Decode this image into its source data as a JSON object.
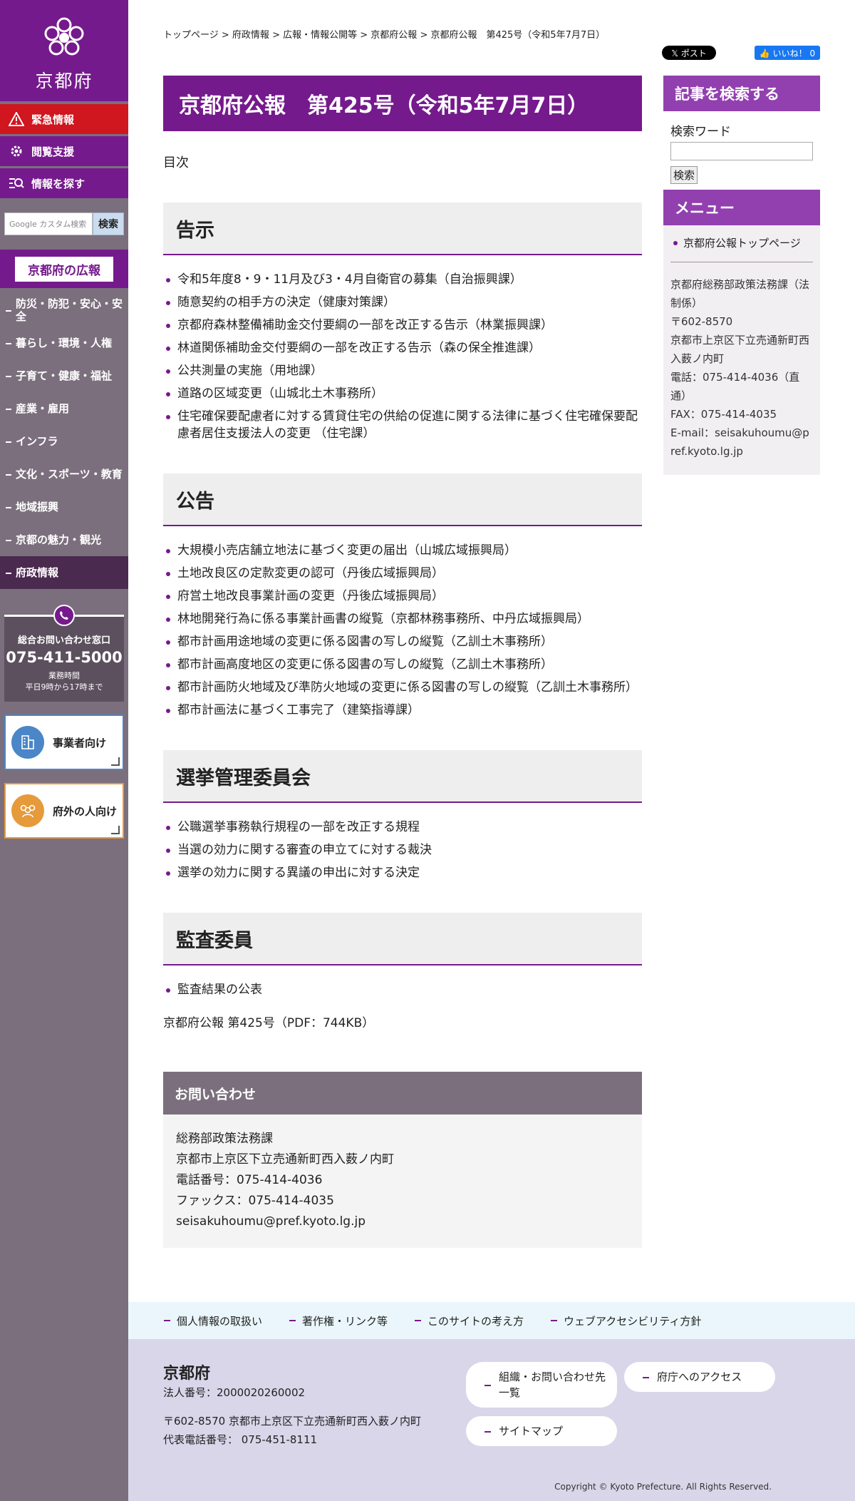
{
  "sidebar": {
    "logo_text": "京都府",
    "buttons": [
      {
        "label": "緊急情報"
      },
      {
        "label": "閲覧支援"
      },
      {
        "label": "情報を探す"
      }
    ],
    "search_placeholder": "Google カスタム検索",
    "search_button": "検索",
    "koho_label": "京都府の広報",
    "nav": [
      {
        "label": "防災・防犯・安心・安全",
        "active": false
      },
      {
        "label": "暮らし・環境・人権",
        "active": false
      },
      {
        "label": "子育て・健康・福祉",
        "active": false
      },
      {
        "label": "産業・雇用",
        "active": false
      },
      {
        "label": "インフラ",
        "active": false
      },
      {
        "label": "文化・スポーツ・教育",
        "active": false
      },
      {
        "label": "地域振興",
        "active": false
      },
      {
        "label": "京都の魅力・観光",
        "active": false
      },
      {
        "label": "府政情報",
        "active": true
      }
    ],
    "contact": {
      "title": "総合お問い合わせ窓口",
      "phone": "075-411-5000",
      "hours_label": "業務時間",
      "hours": "平日9時から17時まで"
    },
    "cards": [
      {
        "label": "事業者向け",
        "color": "#4a86c8"
      },
      {
        "label": "府外の人向け",
        "color": "#e69a3a"
      }
    ]
  },
  "breadcrumb": {
    "items": [
      "トップページ",
      "府政情報",
      "広報・情報公開等",
      "京都府公報"
    ],
    "separator": " > ",
    "current": "京都府公報　第425号（令和5年7月7日）"
  },
  "social": {
    "tweet": "𝕏 ポスト",
    "like": "👍 いいね！ 0"
  },
  "main": {
    "title": "京都府公報　第425号（令和5年7月7日）",
    "toc": "目次",
    "sections": [
      {
        "heading": "告示",
        "items": [
          "令和5年度8・9・11月及び3・4月自衛官の募集（自治振興課）",
          "随意契約の相手方の決定（健康対策課）",
          "京都府森林整備補助金交付要綱の一部を改正する告示（林業振興課）",
          "林道関係補助金交付要綱の一部を改正する告示（森の保全推進課）",
          "公共測量の実施（用地課）",
          "道路の区域変更（山城北土木事務所）",
          "住宅確保要配慮者に対する賃貸住宅の供給の促進に関する法律に基づく住宅確保要配慮者居住支援法人の変更 （住宅課）"
        ]
      },
      {
        "heading": "公告",
        "items": [
          "大規模小売店舗立地法に基づく変更の届出（山城広域振興局）",
          "土地改良区の定款変更の認可（丹後広域振興局）",
          "府営土地改良事業計画の変更（丹後広域振興局）",
          "林地開発行為に係る事業計画書の縦覧（京都林務事務所、中丹広域振興局）",
          "都市計画用途地域の変更に係る図書の写しの縦覧（乙訓土木事務所）",
          "都市計画高度地区の変更に係る図書の写しの縦覧（乙訓土木事務所）",
          "都市計画防火地域及び準防火地域の変更に係る図書の写しの縦覧（乙訓土木事務所）",
          "都市計画法に基づく工事完了（建築指導課）"
        ]
      },
      {
        "heading": "選挙管理委員会",
        "items": [
          "公職選挙事務執行規程の一部を改正する規程",
          "当選の効力に関する審査の申立てに対する裁決",
          "選挙の効力に関する異議の申出に対する決定"
        ]
      },
      {
        "heading": "監査委員",
        "items": [
          "監査結果の公表"
        ]
      }
    ],
    "pdf_link": "京都府公報 第425号（PDF：744KB）",
    "inquiry": {
      "heading": "お問い合わせ",
      "dept": "総務部政策法務課",
      "address": "京都市上京区下立売通新町西入薮ノ内町",
      "phone": "電話番号：075-414-4036",
      "fax": "ファックス：075-414-4035",
      "email": "seisakuhoumu@pref.kyoto.lg.jp"
    }
  },
  "right": {
    "search_heading": "記事を検索する",
    "search_label": "検索ワード",
    "search_button": "検索",
    "menu_heading": "メニュー",
    "menu_link": "京都府公報トップページ",
    "address_lines": [
      "京都府総務部政策法務課（法制係）",
      "〒602-8570",
      "京都市上京区下立売通新町西入薮ノ内町",
      "電話：075-414-4036（直通）",
      "FAX：075-414-4035",
      "E-mail：seisakuhoumu@pref.kyoto.lg.jp"
    ]
  },
  "footer": {
    "links": [
      "個人情報の取扱い",
      "著作権・リンク等",
      "このサイトの考え方",
      "ウェブアクセシビリティ方針"
    ],
    "name": "京都府",
    "corp_number": "法人番号：2000020260002",
    "address": "〒602-8570 京都市上京区下立売通新町西入薮ノ内町",
    "main_phone": "代表電話番号： 075-451-8111",
    "pills": [
      "組織・お問い合わせ先一覧",
      "府庁へのアクセス",
      "サイトマップ"
    ],
    "copyright": "Copyright © Kyoto Prefecture. All Rights Reserved."
  },
  "colors": {
    "brand": "#751a8c",
    "accent": "#9240b0",
    "emergency": "#d0161f",
    "sidebar": "#7b6f7d"
  }
}
